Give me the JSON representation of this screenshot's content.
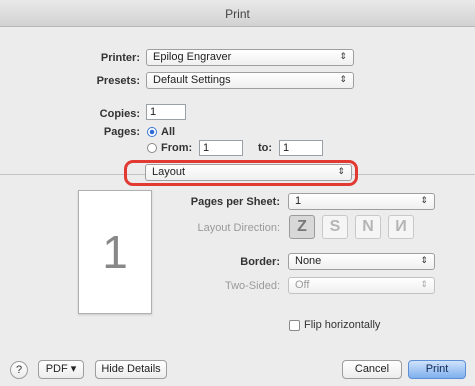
{
  "window": {
    "title": "Print"
  },
  "printer": {
    "label": "Printer:",
    "value": "Epilog Engraver"
  },
  "presets": {
    "label": "Presets:",
    "value": "Default Settings"
  },
  "copies": {
    "label": "Copies:",
    "value": "1"
  },
  "pages": {
    "label": "Pages:",
    "all_label": "All",
    "from_label": "From:",
    "from_value": "1",
    "to_label": "to:",
    "to_value": "1"
  },
  "section_popup": {
    "value": "Layout"
  },
  "preview": {
    "page_number": "1"
  },
  "layout": {
    "pages_per_sheet_label": "Pages per Sheet:",
    "pages_per_sheet_value": "1",
    "direction_label": "Layout Direction:",
    "direction_options": [
      "Z",
      "S",
      "N",
      "И"
    ],
    "border_label": "Border:",
    "border_value": "None",
    "two_sided_label": "Two-Sided:",
    "two_sided_value": "Off",
    "flip_label": "Flip horizontally"
  },
  "footer": {
    "help": "?",
    "pdf_label": "PDF ▾",
    "hide_details_label": "Hide Details",
    "cancel_label": "Cancel",
    "print_label": "Print"
  }
}
